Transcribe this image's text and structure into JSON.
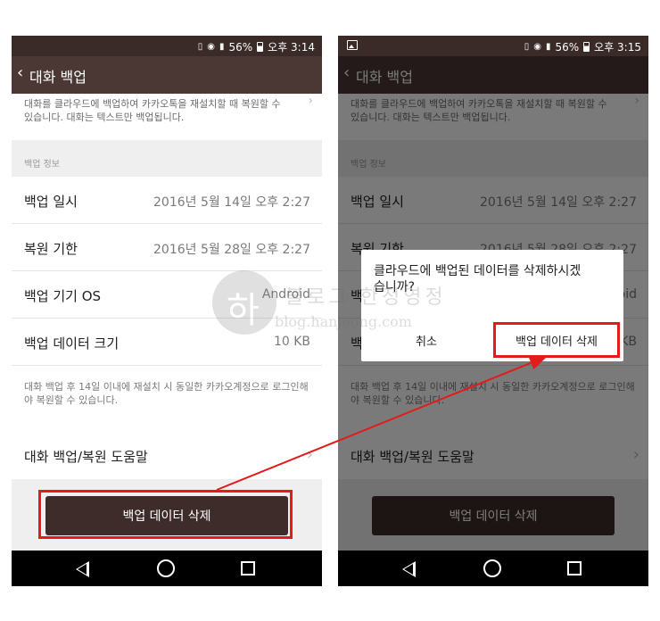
{
  "status_left": {
    "battery": "56%",
    "time": "오후 3:14"
  },
  "status_right": {
    "battery": "56%",
    "time": "오후 3:15"
  },
  "appbar": {
    "back_glyph": "‹",
    "title": "대화 백업"
  },
  "top_card": {
    "description": "대화를 클라우드에 백업하여 카카오톡을 재설치할 때 복원할 수 있습니다. 대화는 텍스트만 백업됩니다."
  },
  "section_label": "백업 정보",
  "info_rows": [
    {
      "label": "백업 일시",
      "value": "2016년 5월 14일 오후 2:27"
    },
    {
      "label": "복원 기한",
      "value": "2016년 5월 28일 오후 2:27"
    },
    {
      "label": "백업 기기 OS",
      "value": "Android"
    },
    {
      "label": "백업 데이터 크기",
      "value": "10 KB"
    }
  ],
  "note": "대화 백업 후 14일 이내에 재설치 시 동일한 카카오계정으로 로그인해야 복원할 수 있습니다.",
  "help_label": "대화 백업/복원 도움말",
  "delete_button_label": "백업 데이터 삭제",
  "dialog": {
    "message": "클라우드에 백업된 데이터를 삭제하시겠습니까?",
    "cancel_label": "취소",
    "confirm_label": "백업 데이터 삭제"
  },
  "watermark": {
    "glyph": "하",
    "text": "블로그 한정영정",
    "url": "blog.hanjeong.com"
  },
  "colors": {
    "appbar": "#4b3835",
    "statusbar": "#3a2a28",
    "highlight": "#e21b1b",
    "delete_button": "#3e2c2a"
  },
  "icons": [
    "vibrate-icon",
    "wifi-icon",
    "signal-icon",
    "battery-icon",
    "image-icon",
    "back-nav-icon",
    "home-nav-icon",
    "recent-apps-icon",
    "chevron-right-icon"
  ]
}
